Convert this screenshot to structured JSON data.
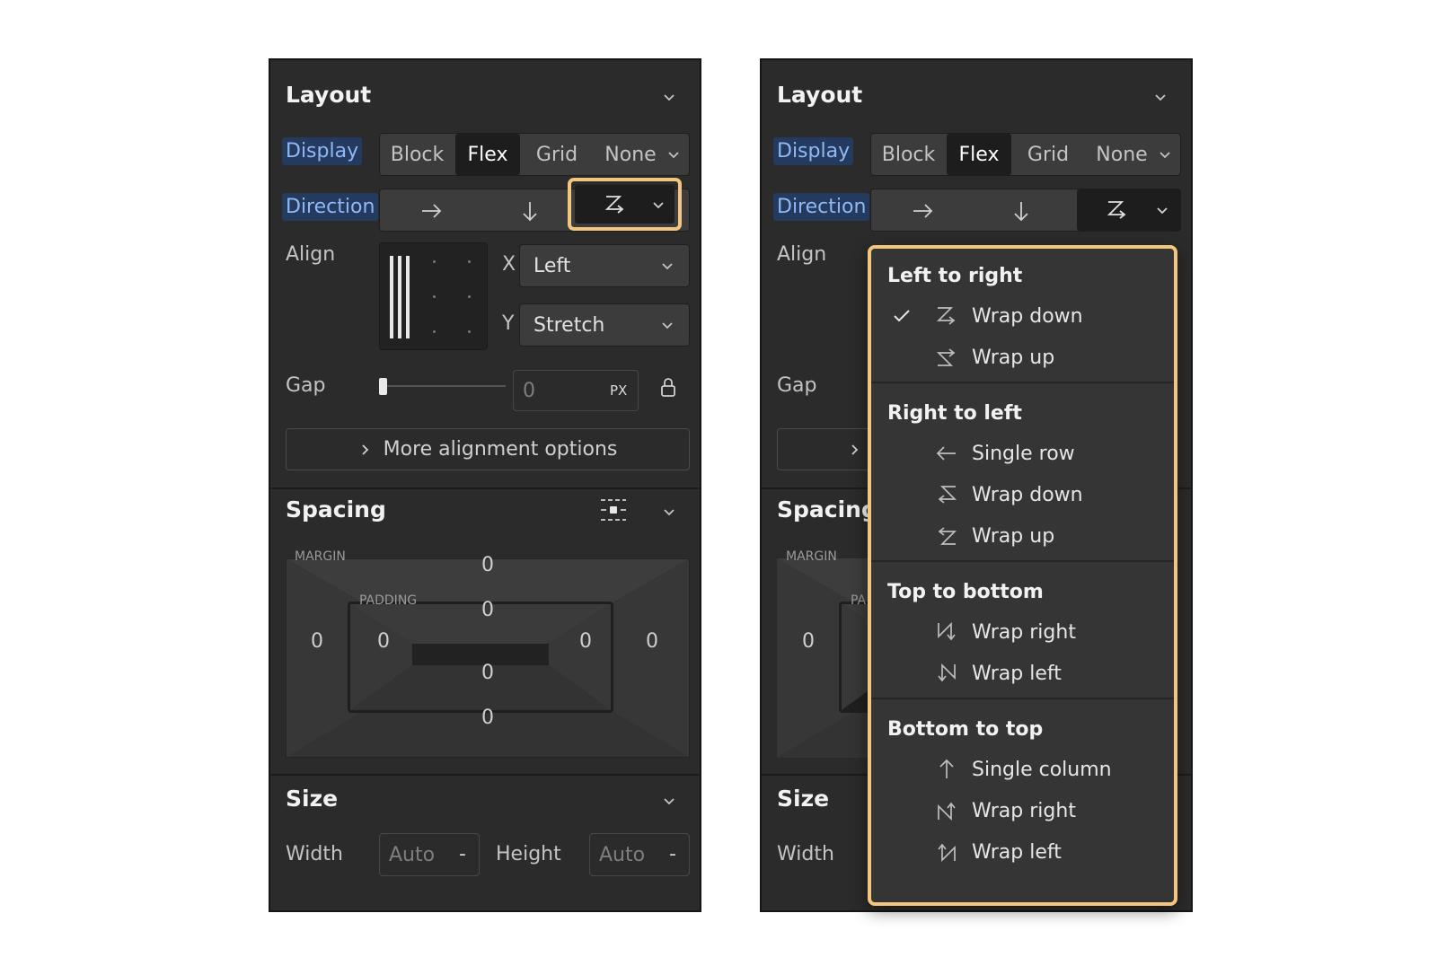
{
  "left_panel": {
    "layout": {
      "title": "Layout",
      "display_label": "Display",
      "display_options": [
        "Block",
        "Flex",
        "Grid",
        "None"
      ],
      "display_selected": "Flex",
      "direction_label": "Direction",
      "align_label": "Align",
      "x_label": "X",
      "x_value": "Left",
      "y_label": "Y",
      "y_value": "Stretch",
      "gap_label": "Gap",
      "gap_value": "0",
      "gap_unit": "PX",
      "more_alignment": "More alignment options"
    },
    "spacing": {
      "title": "Spacing",
      "margin_caption": "MARGIN",
      "padding_caption": "PADDING",
      "margin": {
        "top": "0",
        "right": "0",
        "bottom": "0",
        "left": "0"
      },
      "padding": {
        "top": "0",
        "right": "0",
        "bottom": "0",
        "left": "0"
      }
    },
    "size": {
      "title": "Size",
      "width_label": "Width",
      "width_value": "Auto",
      "width_unit": "-",
      "height_label": "Height",
      "height_value": "Auto",
      "height_unit": "-"
    }
  },
  "right_panel": {
    "layout": {
      "title": "Layout",
      "display_label": "Display",
      "display_options": [
        "Block",
        "Flex",
        "Grid",
        "None"
      ],
      "display_selected": "Flex",
      "direction_label": "Direction",
      "align_label": "Align",
      "gap_label": "Gap"
    },
    "spacing": {
      "title": "Spacing",
      "margin_caption": "MARGIN",
      "padding_caption_visible": "PA",
      "margin_left": "0"
    },
    "size": {
      "title": "Size",
      "width_label": "Width"
    }
  },
  "direction_menu": {
    "sections": [
      {
        "title": "Left to right",
        "items": [
          {
            "label": "Wrap down",
            "icon": "ltr-wrap-down-icon",
            "checked": true
          },
          {
            "label": "Wrap up",
            "icon": "ltr-wrap-up-icon",
            "checked": false
          }
        ]
      },
      {
        "title": "Right to left",
        "items": [
          {
            "label": "Single row",
            "icon": "arrow-left-icon",
            "checked": false
          },
          {
            "label": "Wrap down",
            "icon": "rtl-wrap-down-icon",
            "checked": false
          },
          {
            "label": "Wrap up",
            "icon": "rtl-wrap-up-icon",
            "checked": false
          }
        ]
      },
      {
        "title": "Top to bottom",
        "items": [
          {
            "label": "Wrap right",
            "icon": "ttb-wrap-right-icon",
            "checked": false
          },
          {
            "label": "Wrap left",
            "icon": "ttb-wrap-left-icon",
            "checked": false
          }
        ]
      },
      {
        "title": "Bottom to top",
        "items": [
          {
            "label": "Single column",
            "icon": "arrow-up-icon",
            "checked": false
          },
          {
            "label": "Wrap right",
            "icon": "btt-wrap-right-icon",
            "checked": false
          },
          {
            "label": "Wrap left",
            "icon": "btt-wrap-left-icon",
            "checked": false
          }
        ]
      }
    ]
  },
  "colors": {
    "panel_bg": "#2b2b2b",
    "highlight": "#f3c57f",
    "pill_bg": "#243a5e",
    "pill_text": "#8fb8f5"
  }
}
